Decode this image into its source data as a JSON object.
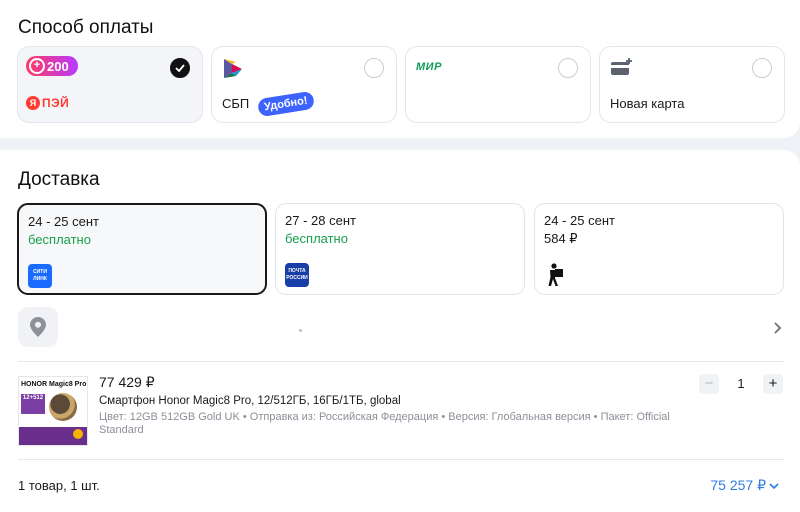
{
  "payment": {
    "title": "Способ оплаты",
    "options": [
      {
        "badge_value": "200",
        "logo_text": "ПЭЙ",
        "logo_letter": "Я",
        "selected": true
      },
      {
        "label": "СБП",
        "promo": "Удобно!",
        "selected": false
      },
      {
        "logo_text": "МИР",
        "selected": false
      },
      {
        "label": "Новая карта",
        "selected": false
      }
    ]
  },
  "delivery": {
    "title": "Доставка",
    "options": [
      {
        "date": "24 - 25 сент",
        "price": "бесплатно",
        "logo": "СИТИ ЛИНК",
        "logo_color": "#1a6cff",
        "selected": true
      },
      {
        "date": "27 - 28 сент",
        "price": "бесплатно",
        "logo": "ПОЧТА РОССИИ",
        "logo_color": "#1a3ea8",
        "selected": false
      },
      {
        "date": "24 - 25 сент",
        "price": "584 ₽",
        "logo": "courier-icon",
        "selected": false
      }
    ]
  },
  "product": {
    "price": "77 429 ₽",
    "name": "Смартфон Honor Magic8 Pro, 12/512ГБ, 16ГБ/1ТБ, global",
    "attributes": "Цвет: 12GB 512GB Gold UK • Отправка из: Российская Федерация • Версия: Глобальная версия • Пакет: Official Standard",
    "thumb_brand": "HONOR Magic8 Pro",
    "thumb_spec": "12+512",
    "quantity": "1",
    "minus": "−",
    "plus": "+"
  },
  "summary": {
    "count": "1 товар, 1 шт.",
    "total": "75 257 ₽"
  },
  "colors": {
    "accent_blue": "#2f7ce6",
    "free_green": "#18a04b",
    "selected_border": "#1a1a1a"
  }
}
